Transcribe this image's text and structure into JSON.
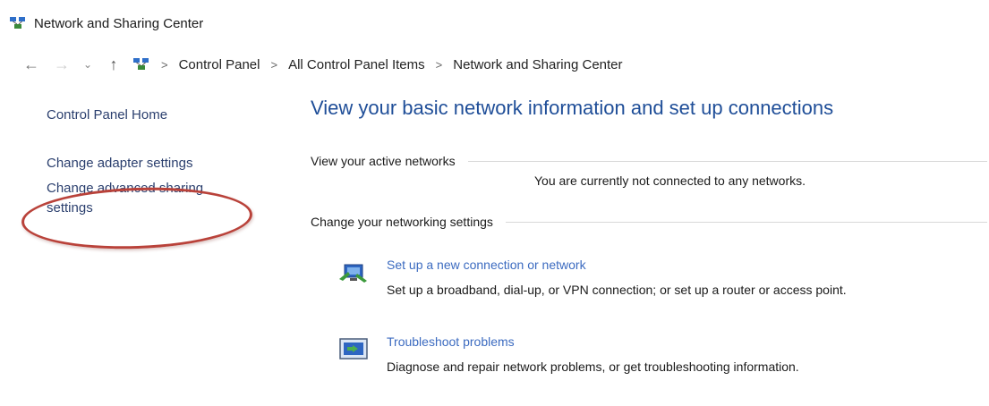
{
  "window": {
    "title": "Network and Sharing Center",
    "icon": "network-icon"
  },
  "address_bar": {
    "back_icon": "back-arrow-icon",
    "forward_icon": "forward-arrow-icon",
    "recent_icon": "chevron-down-icon",
    "up_icon": "up-arrow-icon",
    "separator": ">",
    "breadcrumbs": [
      "Control Panel",
      "All Control Panel Items",
      "Network and Sharing Center"
    ]
  },
  "sidebar": {
    "links": [
      {
        "label": "Control Panel Home"
      },
      {
        "label": "Change adapter settings"
      },
      {
        "label": "Change advanced sharing settings"
      }
    ],
    "highlight_color": "#b9423a"
  },
  "main": {
    "heading": "View your basic network information and set up connections",
    "active_networks": {
      "title": "View your active networks",
      "status": "You are currently not connected to any networks."
    },
    "networking_settings": {
      "title": "Change your networking settings",
      "tasks": [
        {
          "icon": "new-connection-icon",
          "link": "Set up a new connection or network",
          "description": "Set up a broadband, dial-up, or VPN connection; or set up a router or access point."
        },
        {
          "icon": "troubleshoot-icon",
          "link": "Troubleshoot problems",
          "description": "Diagnose and repair network problems, or get troubleshooting information."
        }
      ]
    }
  },
  "colors": {
    "heading": "#1f4e98",
    "link": "#3c6bc0",
    "sidebar_link": "#2b3f6e"
  }
}
